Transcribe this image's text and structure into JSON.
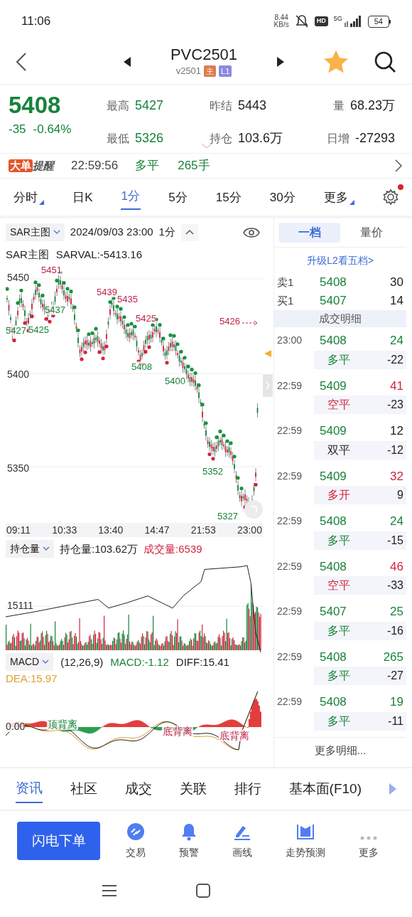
{
  "status_bar": {
    "time": "11:06",
    "speed": "8.44",
    "speed_unit": "KB/s",
    "hd": "HD",
    "network": "5G",
    "battery": "54"
  },
  "header": {
    "title": "PVC2501",
    "code": "v2501",
    "favorited": true,
    "badges": [
      {
        "text": "主",
        "kind": "main"
      },
      {
        "text": "L1",
        "kind": "level"
      }
    ]
  },
  "quote": {
    "price": "5408",
    "change": "-35",
    "change_pct": "-0.64%",
    "stats": [
      {
        "label": "最高",
        "value": "5427",
        "color": "#17833a"
      },
      {
        "label": "昨结",
        "value": "5443",
        "color": "#222222"
      },
      {
        "label": "量",
        "value": "68.23万",
        "color": "#222222"
      },
      {
        "label": "最低",
        "value": "5326",
        "color": "#17833a"
      },
      {
        "label": "持仓",
        "value": "103.6万",
        "color": "#222222"
      },
      {
        "label": "日增",
        "value": "-27293",
        "color": "#222222"
      }
    ]
  },
  "alert": {
    "badge_a": "大单",
    "badge_b": "提醒",
    "time": "22:59:56",
    "action": "多平",
    "volume": "265手"
  },
  "periods": [
    {
      "label": "分时",
      "menu": true,
      "selected": false
    },
    {
      "label": "日K",
      "menu": false,
      "selected": false
    },
    {
      "label": "1分",
      "menu": false,
      "selected": true
    },
    {
      "label": "5分",
      "menu": false,
      "selected": false
    },
    {
      "label": "15分",
      "menu": false,
      "selected": false
    },
    {
      "label": "30分",
      "menu": false,
      "selected": false
    },
    {
      "label": "更多",
      "menu": true,
      "selected": false
    }
  ],
  "settings_notice": true,
  "main_chart": {
    "indicator": "SAR主图",
    "datetime": "2024/09/03 23:00",
    "period": "1分",
    "legend_name": "SAR主图",
    "legend_value": "SARVAL:-5413.16",
    "axis_labels": [
      "5450",
      "5400",
      "5350"
    ],
    "marks": [
      {
        "text": "5451",
        "kind": "high"
      },
      {
        "text": "5439",
        "kind": "high"
      },
      {
        "text": "5435",
        "kind": "high"
      },
      {
        "text": "5425",
        "kind": "high"
      },
      {
        "text": "5426",
        "kind": "high"
      },
      {
        "text": "5437",
        "kind": "low"
      },
      {
        "text": "5427",
        "kind": "low"
      },
      {
        "text": "5425",
        "kind": "low"
      },
      {
        "text": "5408",
        "kind": "low"
      },
      {
        "text": "5400",
        "kind": "low"
      },
      {
        "text": "5352",
        "kind": "low"
      },
      {
        "text": "5327",
        "kind": "low"
      }
    ],
    "times": [
      "09:11",
      "10:33",
      "13:40",
      "14:47",
      "21:53",
      "23:00"
    ]
  },
  "oi_chart": {
    "indicator": "持仓量",
    "oi": "持仓量:103.62万",
    "volume": "成交量:6539",
    "axis_label": "15111"
  },
  "macd_chart": {
    "indicator": "MACD",
    "params": "(12,26,9)",
    "macd": "MACD:-1.12",
    "diff": "DIFF:15.41",
    "dea": "DEA:15.97",
    "axis_label": "0.00",
    "marks": [
      {
        "text": "顶背离",
        "kind": "top"
      },
      {
        "text": "底背离",
        "kind": "bottom"
      },
      {
        "text": "底背离",
        "kind": "bottom"
      }
    ]
  },
  "order_panel": {
    "tabs": [
      {
        "label": "一档",
        "selected": true
      },
      {
        "label": "量价",
        "selected": false
      }
    ],
    "upgrade_link": "升级L2看五档>",
    "book": [
      {
        "side": "卖1",
        "price": "5408",
        "qty": "30"
      },
      {
        "side": "买1",
        "price": "5407",
        "qty": "14"
      }
    ],
    "section_title": "成交明细",
    "trades": [
      {
        "time": "23:00",
        "price": "5408",
        "volume": {
          "text": "24",
          "color": "#17833a"
        },
        "type": {
          "text": "多平",
          "color": "#17833a"
        },
        "change": "-22"
      },
      {
        "time": "22:59",
        "price": "5409",
        "volume": {
          "text": "41",
          "color": "#d2253e"
        },
        "type": {
          "text": "空平",
          "color": "#d2253e"
        },
        "change": "-23"
      },
      {
        "time": "22:59",
        "price": "5409",
        "volume": {
          "text": "12",
          "color": "#222222"
        },
        "type": {
          "text": "双平",
          "color": "#222222"
        },
        "change": "-12"
      },
      {
        "time": "22:59",
        "price": "5409",
        "volume": {
          "text": "32",
          "color": "#d2253e"
        },
        "type": {
          "text": "多开",
          "color": "#d2253e"
        },
        "change": "9"
      },
      {
        "time": "22:59",
        "price": "5408",
        "volume": {
          "text": "24",
          "color": "#17833a"
        },
        "type": {
          "text": "多平",
          "color": "#17833a"
        },
        "change": "-15"
      },
      {
        "time": "22:59",
        "price": "5408",
        "volume": {
          "text": "46",
          "color": "#d2253e"
        },
        "type": {
          "text": "空平",
          "color": "#d2253e"
        },
        "change": "-33"
      },
      {
        "time": "22:59",
        "price": "5407",
        "volume": {
          "text": "25",
          "color": "#17833a"
        },
        "type": {
          "text": "多平",
          "color": "#17833a"
        },
        "change": "-16"
      },
      {
        "time": "22:59",
        "price": "5408",
        "volume": {
          "text": "265",
          "color": "#17833a"
        },
        "type": {
          "text": "多平",
          "color": "#17833a"
        },
        "change": "-27"
      },
      {
        "time": "22:59",
        "price": "5408",
        "volume": {
          "text": "19",
          "color": "#17833a"
        },
        "type": {
          "text": "多平",
          "color": "#17833a"
        },
        "change": "-11"
      }
    ],
    "more": "更多明细..."
  },
  "bottom_tabs": [
    {
      "label": "资讯",
      "selected": true
    },
    {
      "label": "社区",
      "selected": false
    },
    {
      "label": "成交",
      "selected": false
    },
    {
      "label": "关联",
      "selected": false
    },
    {
      "label": "排行",
      "selected": false
    },
    {
      "label": "基本面(F10)",
      "selected": false
    }
  ],
  "actions": {
    "primary": "闪电下单",
    "items": [
      {
        "label": "交易",
        "kind": "trade"
      },
      {
        "label": "预警",
        "kind": "alert"
      },
      {
        "label": "画线",
        "kind": "draw"
      },
      {
        "label": "走势预测",
        "kind": "forecast"
      },
      {
        "label": "更多",
        "kind": "more"
      }
    ]
  }
}
